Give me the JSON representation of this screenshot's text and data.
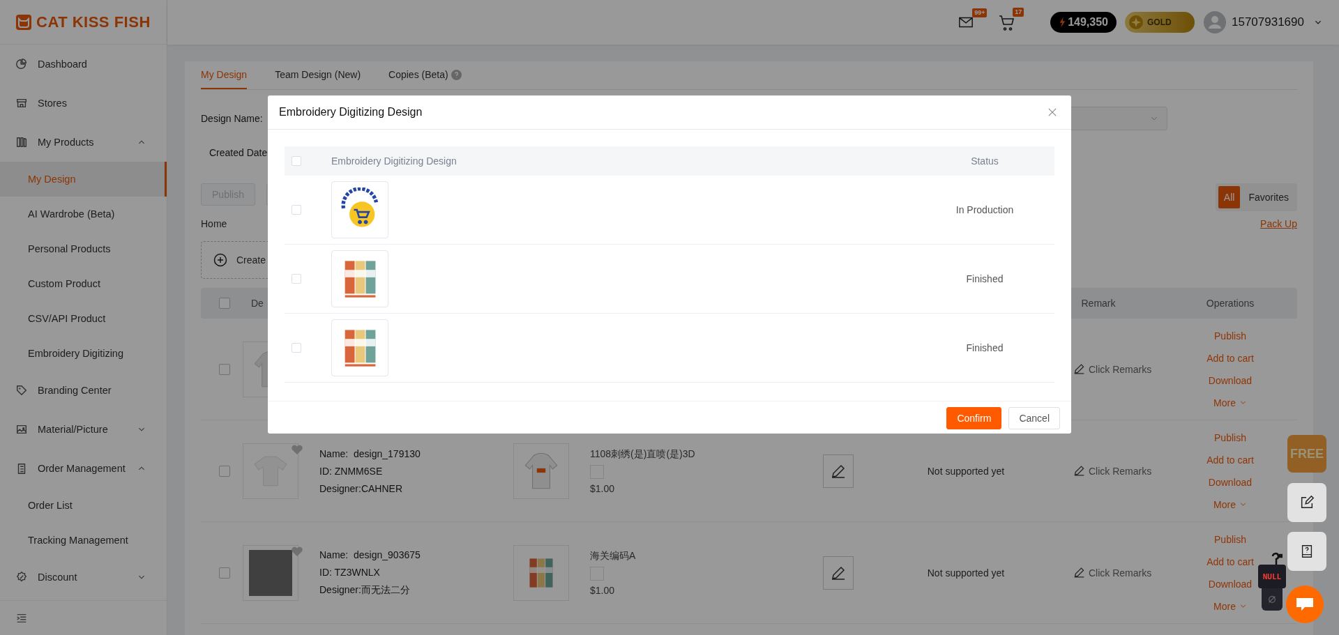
{
  "brand": {
    "name": "CAT KISS FISH"
  },
  "header": {
    "messages_badge": "99+",
    "cart_badge": "17",
    "points": "149,350",
    "tier": "GOLD",
    "account": "15707931690"
  },
  "sidebar": {
    "items": [
      {
        "label": "Dashboard",
        "selected": false
      },
      {
        "label": "Stores",
        "selected": false
      },
      {
        "label": "My Products",
        "selected": false,
        "expanded": true,
        "children": [
          {
            "label": "My Design",
            "selected": true
          },
          {
            "label": "AI Wardrobe (Beta)",
            "selected": false
          },
          {
            "label": "Personal Products",
            "selected": false
          },
          {
            "label": "Custom Product",
            "selected": false
          },
          {
            "label": "CSV/API Product",
            "selected": false
          },
          {
            "label": "Embroidery Digitizing",
            "selected": false
          }
        ]
      },
      {
        "label": "Branding Center",
        "selected": false
      },
      {
        "label": "Material/Picture",
        "selected": false,
        "expanded": false
      },
      {
        "label": "Order Management",
        "selected": false,
        "expanded": true,
        "children": [
          {
            "label": "Order List",
            "selected": false
          },
          {
            "label": "Tracking Management",
            "selected": false
          }
        ]
      },
      {
        "label": "Discount",
        "selected": false,
        "expanded": false
      }
    ]
  },
  "tabs": [
    {
      "label": "My Design",
      "selected": true,
      "info_icon": false
    },
    {
      "label": "Team Design (New)",
      "selected": false,
      "info_icon": false
    },
    {
      "label": "Copies (Beta)",
      "selected": false,
      "info_icon": true
    }
  ],
  "filters": {
    "design_name_label": "Design Name:",
    "created_date_label": "Created Date"
  },
  "toolbar": {
    "publish": {
      "label": "Publish",
      "disabled": true
    }
  },
  "view_toggle": [
    {
      "label": "All",
      "selected": true
    },
    {
      "label": "Favorites",
      "selected": false
    }
  ],
  "breadcrumb": "Home",
  "pack_up": "Pack Up",
  "create_folder": "Create",
  "table": {
    "columns": [
      "De",
      "Remark",
      "Operations"
    ],
    "all_checked": false,
    "rows": [
      {
        "kind": "partial",
        "checked": false,
        "thumbnail": {
          "kind": "hoodie"
        },
        "remark": "Click Remarks",
        "operations": [
          "Publish",
          "Add to cart",
          "Download",
          "More"
        ]
      },
      {
        "kind": "full",
        "checked": false,
        "thumbnail": {
          "kind": "tshirt"
        },
        "favorite": false,
        "name": "Name:  design_179130",
        "id": "ID: ZNMM6SE",
        "designer": "Designer:CAHNER",
        "product_image": {
          "kind": "hoodie"
        },
        "product_name": "1108刺绣(是)直喷(是)3D",
        "price": "$1.00",
        "status": "Not supported yet",
        "remark": "Click Remarks",
        "operations": [
          "Publish",
          "Add to cart",
          "Download",
          "More"
        ]
      },
      {
        "kind": "full",
        "checked": false,
        "thumbnail": {
          "kind": "photo"
        },
        "favorite": false,
        "name": "Name:  design_903675",
        "id": "ID: TZ3WNLX",
        "designer": "Designer:而无法二分",
        "product_image": {
          "kind": "poster"
        },
        "product_name": "海关编码A",
        "price": "$1.00",
        "status": "Not supported yet",
        "remark": "Click Remarks",
        "operations": [
          "Publish",
          "Add to cart",
          "Download",
          "More"
        ]
      }
    ]
  },
  "modal": {
    "title": "Embroidery Digitizing Design",
    "columns": [
      "Embroidery Digitizing Design",
      "Status"
    ],
    "all_checked": false,
    "rows": [
      {
        "checked": false,
        "design": {
          "kind": "logo"
        },
        "status": "In Production"
      },
      {
        "checked": false,
        "design": {
          "kind": "poster"
        },
        "status": "Finished"
      },
      {
        "checked": false,
        "design": {
          "kind": "poster"
        },
        "status": "Finished"
      }
    ],
    "buttons": [
      {
        "label": "Confirm",
        "kind": "primary"
      },
      {
        "label": "Cancel",
        "kind": "default"
      }
    ]
  },
  "floating": {
    "free_badge": "FREE",
    "mascot_text": "NULL"
  }
}
